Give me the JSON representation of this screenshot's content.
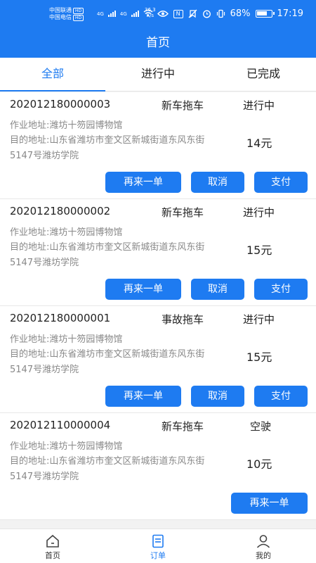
{
  "status_bar": {
    "carrier_1": "中国联通",
    "carrier_2": "中国电信",
    "hd": "HD",
    "net_1": "4G",
    "net_2": "4G",
    "speed_value": "36.3",
    "speed_unit": "K/s",
    "nfc": "N",
    "battery": "68%",
    "time": "17:19"
  },
  "header": {
    "title": "首页"
  },
  "tabs": [
    {
      "label": "全部",
      "active": true
    },
    {
      "label": "进行中",
      "active": false
    },
    {
      "label": "已完成",
      "active": false
    }
  ],
  "labels": {
    "again": "再来一单",
    "cancel": "取消",
    "pay": "支付"
  },
  "orders": [
    {
      "no": "202012180000003",
      "type": "新车拖车",
      "state": "进行中",
      "work": "作业地址:潍坊十笏园博物馆",
      "dest": "目的地址:山东省潍坊市奎文区新城街道东风东街5147号潍坊学院",
      "price": "14元"
    },
    {
      "no": "202012180000002",
      "type": "新车拖车",
      "state": "进行中",
      "work": "作业地址:潍坊十笏园博物馆",
      "dest": "目的地址:山东省潍坊市奎文区新城街道东风东街5147号潍坊学院",
      "price": "15元"
    },
    {
      "no": "202012180000001",
      "type": "事故拖车",
      "state": "进行中",
      "work": "作业地址:潍坊十笏园博物馆",
      "dest": "目的地址:山东省潍坊市奎文区新城街道东风东街5147号潍坊学院",
      "price": "15元"
    },
    {
      "no": "202012110000004",
      "type": "新车拖车",
      "state": "空驶",
      "work": "作业地址:潍坊十笏园博物馆",
      "dest": "目的地址:山东省潍坊市奎文区新城街道东风东街5147号潍坊学院",
      "price": "10元"
    }
  ],
  "bottom_nav": [
    {
      "label": "首页",
      "icon": "home-icon",
      "active": false
    },
    {
      "label": "订单",
      "icon": "order-icon",
      "active": true
    },
    {
      "label": "我的",
      "icon": "profile-icon",
      "active": false
    }
  ],
  "colors": {
    "accent": "#1e7bf1",
    "muted_text": "#888888",
    "background": "#f2f2f2"
  }
}
